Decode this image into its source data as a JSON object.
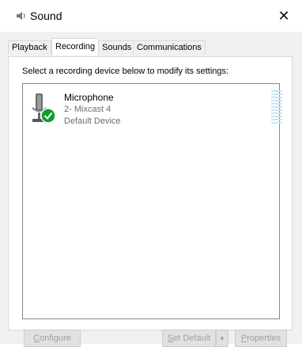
{
  "window": {
    "title": "Sound",
    "close_glyph": "✕",
    "icon": "speaker-icon"
  },
  "tabs": [
    {
      "label": "Playback",
      "active": false
    },
    {
      "label": "Recording",
      "active": true
    },
    {
      "label": "Sounds",
      "active": false
    },
    {
      "label": "Communications",
      "active": false
    }
  ],
  "recording": {
    "instruction": "Select a recording device below to modify its settings:",
    "devices": [
      {
        "name": "Microphone",
        "detail": "2- Mixcast 4",
        "status": "Default Device",
        "icon": "microphone-icon",
        "badge": "green-check-icon"
      }
    ]
  },
  "buttons": {
    "configure": {
      "first": "C",
      "rest": "onfigure",
      "enabled": false
    },
    "set_default": {
      "first": "S",
      "rest": "et Default",
      "enabled": false
    },
    "set_default_arrow": "▼",
    "properties": {
      "first": "P",
      "rest": "roperties",
      "enabled": false
    }
  },
  "colors": {
    "accent_check": "#0f9d2f",
    "level_bar": "#c6e7f2",
    "disabled_text": "#a0a0a0"
  }
}
